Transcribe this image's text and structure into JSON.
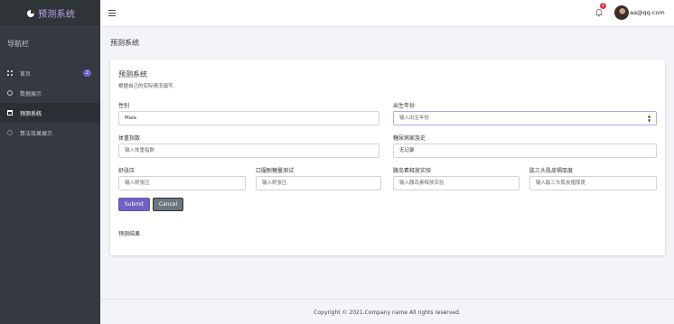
{
  "brand": {
    "title": "预测系统"
  },
  "sidebar": {
    "header": "导航栏",
    "items": [
      {
        "label": "首页",
        "badge": "2",
        "icon": "grid-icon"
      },
      {
        "label": "数据展示",
        "icon": "circle-icon"
      },
      {
        "label": "预测系统",
        "icon": "calendar-icon",
        "active": true
      },
      {
        "label": "算法效果展示",
        "icon": "gear-icon"
      }
    ]
  },
  "topbar": {
    "notification_count": "2",
    "user_email": "aa@qq.com"
  },
  "page": {
    "title": "预测系统"
  },
  "card": {
    "title": "预测系统",
    "subtitle": "根据自己的实际情况填写.",
    "fields": {
      "gender": {
        "label": "性别",
        "value": "Male"
      },
      "birth_year": {
        "label": "出生年份",
        "placeholder": "输入出生年份"
      },
      "bmi": {
        "label": "体重指数",
        "placeholder": "输入体重指数"
      },
      "family_history": {
        "label": "糖尿病家族史",
        "value": "无记录"
      },
      "diastolic": {
        "label": "舒张压",
        "placeholder": "输入舒张压"
      },
      "ogtt": {
        "label": "口服耐糖量测试",
        "placeholder": "输入舒张压"
      },
      "insulin": {
        "label": "胰岛素释放实验",
        "placeholder": "输入胰岛素释放实验"
      },
      "triceps": {
        "label": "肱三头肌皮褶厚度",
        "placeholder": "输入肱三头肌皮褶厚度"
      }
    },
    "submit_label": "Submit",
    "cancel_label": "Cancel",
    "result_label": "预测结果"
  },
  "footer": {
    "text": "Copyright © 2021.Company name All rights reserved."
  },
  "colors": {
    "accent": "#6f62c2",
    "sidebar_bg": "#343a40",
    "brand_text": "#b9a7ef"
  }
}
